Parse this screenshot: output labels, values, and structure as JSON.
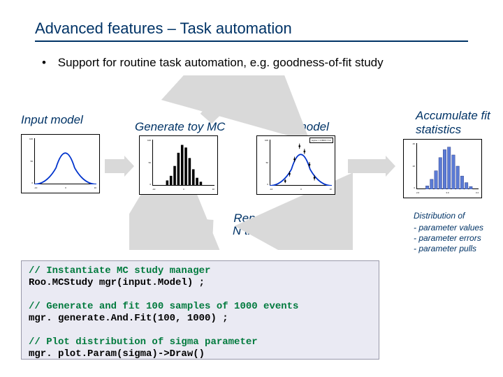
{
  "title": "Advanced features – Task automation",
  "bullet": "Support for routine task automation, e.g. goodness-of-fit study",
  "labels": {
    "input": "Input model",
    "generate": "Generate toy MC",
    "fit": "Fit model",
    "accumulate": "Accumulate fit statistics",
    "repeat": "Repeat\nN times"
  },
  "footnote": {
    "header": "Distribution of",
    "items": [
      "- parameter values",
      "- parameter errors",
      "- parameter pulls"
    ]
  },
  "code": {
    "c1": "// Instantiate MC study manager",
    "s1": "Roo.MCStudy mgr(input.Model) ;",
    "c2": "// Generate and fit 100 samples of 1000 events",
    "s2": "mgr. generate.And.Fit(100, 1000) ;",
    "c3": "// Plot distribution of sigma parameter",
    "s3": "mgr. plot.Param(sigma)->Draw()"
  },
  "fit_legend": "sigma = 3.0990 ± 0.2",
  "plot_style": {
    "curve_color": "#0033cc",
    "hist_fill": "#5b7bd5",
    "point_color": "#000"
  }
}
